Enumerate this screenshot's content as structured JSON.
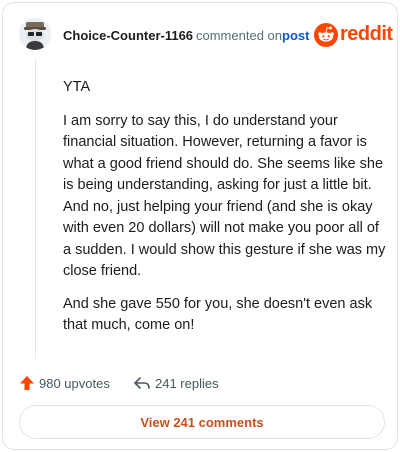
{
  "header": {
    "author": "Choice-Counter-1166",
    "commented_on": "commented on",
    "post_link": "post",
    "brand": "reddit",
    "brand_color": "#ff4500",
    "avatar_icon": "snoo-avatar-icon"
  },
  "comment": {
    "paragraphs": [
      "YTA",
      "I am sorry to say this, I do understand your financial situation. However, returning a favor is what a good friend should do. She seems like she is being understanding, asking for just a little bit. And no, just helping your friend (and she is okay with even 20 dollars) will not make you poor all of a sudden. I would show this gesture if she was my close friend.",
      "And she gave 550 for you, she doesn't even ask that much, come on!"
    ]
  },
  "actions": {
    "upvotes": "980 upvotes",
    "replies": "241 replies",
    "upvote_icon": "upvote-arrow-icon",
    "reply_icon": "reply-arrow-icon"
  },
  "view_comments": "View 241 comments"
}
